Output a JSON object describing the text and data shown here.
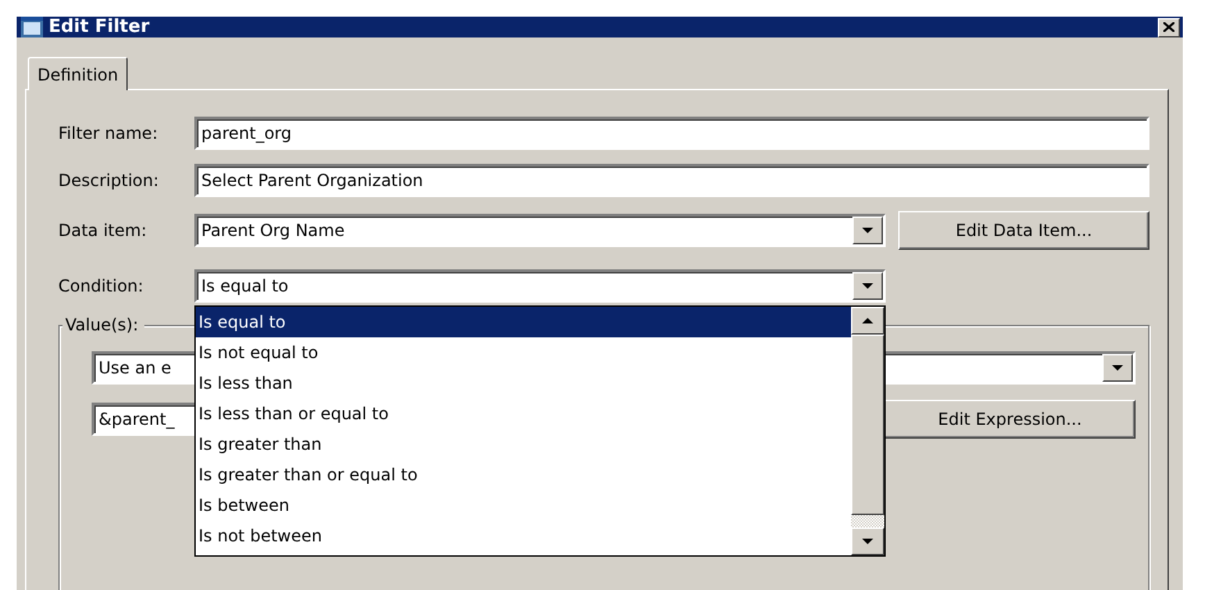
{
  "window": {
    "title": "Edit Filter"
  },
  "tabs": [
    {
      "label": "Definition",
      "selected": true
    }
  ],
  "filter_name": {
    "label": "Filter name:",
    "value": "parent_org"
  },
  "description": {
    "label": "Description:",
    "value": "Select Parent Organization"
  },
  "data_item": {
    "label": "Data item:",
    "value": "Parent Org Name",
    "button": "Edit Data Item..."
  },
  "condition": {
    "label": "Condition:",
    "value": "Is equal to",
    "expanded": true,
    "options": [
      {
        "label": "Is equal to",
        "selected": true
      },
      {
        "label": "Is not equal to",
        "selected": false
      },
      {
        "label": "Is less than",
        "selected": false
      },
      {
        "label": "Is less than or equal to",
        "selected": false
      },
      {
        "label": "Is greater than",
        "selected": false
      },
      {
        "label": "Is greater than or equal to",
        "selected": false
      },
      {
        "label": "Is between",
        "selected": false
      },
      {
        "label": "Is not between",
        "selected": false
      }
    ]
  },
  "values": {
    "label": "Value(s):",
    "source_value": "Use an e",
    "expression_value": "&parent_",
    "button": "Edit Expression..."
  }
}
